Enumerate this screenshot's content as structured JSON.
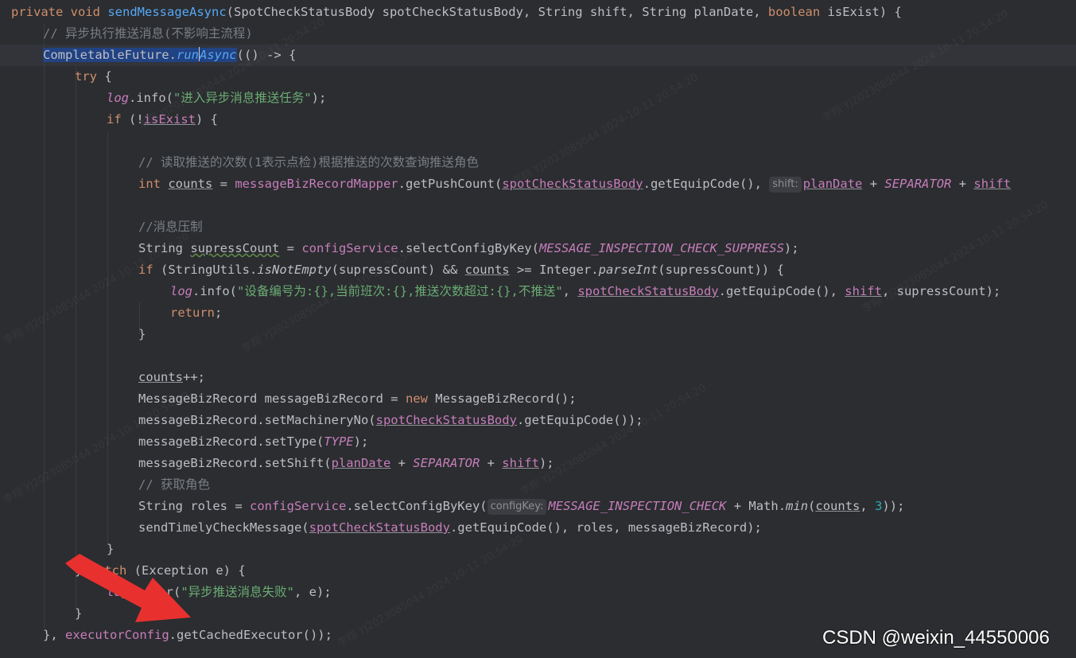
{
  "code": {
    "l1": {
      "kw1": "private",
      "kw2": "void",
      "fn": "sendMessageAsync",
      "params": "(SpotCheckStatusBody spotCheckStatusBody, String shift, String planDate, ",
      "kw3": "boolean",
      "tail": " isExist) {"
    },
    "l2": {
      "comment": "// 异步执行推送消息(不影响主流程)"
    },
    "l3": {
      "sel1": "CompletableFuture.",
      "sel2": "run",
      "sel3": "Async",
      "tail": "(() -> {"
    },
    "l4": {
      "kw": "try",
      "tail": " {"
    },
    "l5": {
      "fld": "log",
      "mid": ".info(",
      "str": "\"进入异步消息推送任务\"",
      "tail": ");"
    },
    "l6": {
      "kw": "if",
      "mid": " (!",
      "var": "isExist",
      "tail": ") {"
    },
    "l7": {
      "comment": "// 读取推送的次数(1表示点检)根据推送的次数查询推送角色"
    },
    "l8": {
      "kw": "int",
      "var": "counts",
      "eq": " = ",
      "fld": "messageBizRecordMapper",
      "call": ".getPushCount(",
      "arg": "spotCheckStatusBody",
      "call2": ".getEquipCode(), ",
      "hint": "shift:",
      "pd": "planDate",
      "plus": " + ",
      "sep": "SEPARATOR",
      "plus2": " + ",
      "sh": "shift"
    },
    "l9": {
      "comment": "//消息压制"
    },
    "l10": {
      "t1": "String ",
      "var": "supressCount",
      "eq": " = ",
      "fld": "configService",
      "call": ".selectConfigByKey(",
      "const": "MESSAGE_INSPECTION_CHECK_SUPPRESS",
      "tail": ");"
    },
    "l11": {
      "kw": "if",
      "mid": " (StringUtils.",
      "m": "isNotEmpty",
      "mid2": "(supressCount) && ",
      "var": "counts",
      "mid3": " >= Integer.",
      "m2": "parseInt",
      "tail": "(supressCount)) {"
    },
    "l12": {
      "fld": "log",
      "mid": ".info(",
      "str": "\"设备编号为:{},当前班次:{},推送次数超过:{},不推送\"",
      "c1": ", ",
      "arg": "spotCheckStatusBody",
      "mid2": ".getEquipCode(), ",
      "sh": "shift",
      "tail": ", supressCount);"
    },
    "l13": {
      "kw": "return",
      "tail": ";"
    },
    "l14": {
      "text": "}"
    },
    "l15": {
      "var": "counts",
      "tail": "++;"
    },
    "l16": {
      "t1": "MessageBizRecord messageBizRecord = ",
      "kw": "new",
      "tail": " MessageBizRecord();"
    },
    "l17": {
      "t1": "messageBizRecord.setMachineryNo(",
      "arg": "spotCheckStatusBody",
      "tail": ".getEquipCode());"
    },
    "l18": {
      "t1": "messageBizRecord.setType(",
      "const": "TYPE",
      "tail": ");"
    },
    "l19": {
      "t1": "messageBizRecord.setShift(",
      "pd": "planDate",
      "plus": " + ",
      "sep": "SEPARATOR",
      "plus2": " + ",
      "sh": "shift",
      "tail": ");"
    },
    "l20": {
      "comment": "// 获取角色"
    },
    "l21": {
      "t1": "String roles = ",
      "fld": "configService",
      "call": ".selectConfigByKey(",
      "hint": "configKey:",
      "const": "MESSAGE_INSPECTION_CHECK",
      "plus": " + Math.",
      "m": "min",
      "p": "(",
      "var": "counts",
      "c": ", ",
      "num": "3",
      "tail": "));"
    },
    "l22": {
      "t1": "sendTimelyCheckMessage(",
      "arg": "spotCheckStatusBody",
      "tail": ".getEquipCode(), roles, messageBizRecord);"
    },
    "l23": {
      "text": "}"
    },
    "l24": {
      "t1": "} ",
      "kw": "catch",
      "tail": " (Exception e) {"
    },
    "l25": {
      "fld": "log",
      "mid": ".error(",
      "str": "\"异步推送消息失败\"",
      "tail": ", e);"
    },
    "l26": {
      "text": "}"
    },
    "l27": {
      "t1": "}, ",
      "fld": "executorConfig",
      "tail": ".getCachedExecutor());"
    }
  },
  "watermark": {
    "text": "李翔 YJ2023085044 2024-10-11 20:54:20"
  },
  "credit": {
    "text": "CSDN @weixin_44550006"
  },
  "colors": {
    "background": "#2b2d30",
    "keyword": "#cf8e6d",
    "function": "#56a8f5",
    "field": "#c77dbb",
    "string": "#6aab73",
    "comment": "#7a7e85",
    "arrow": "#e8312f"
  }
}
